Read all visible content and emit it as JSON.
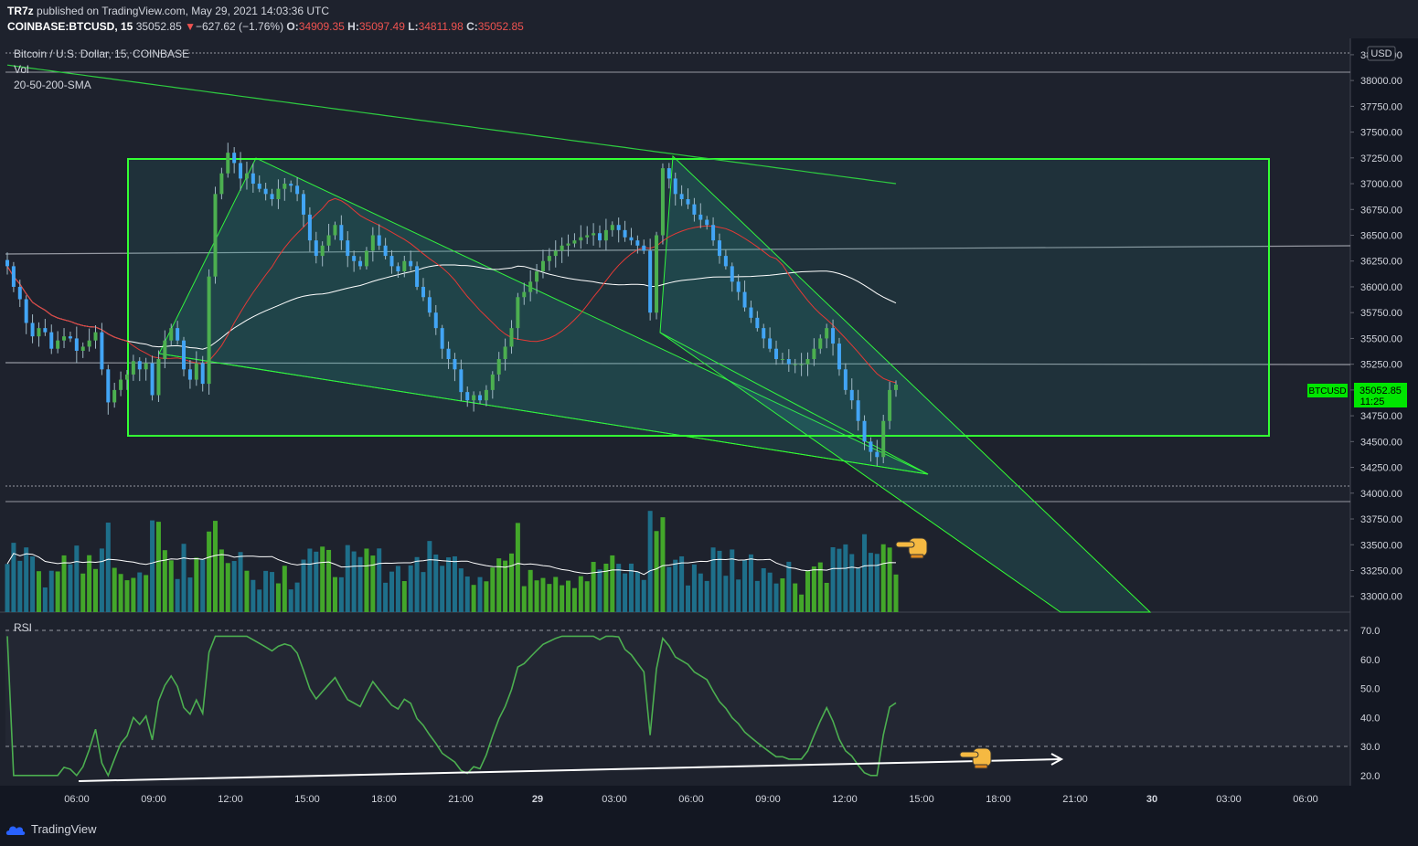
{
  "header": {
    "author": "TR7z",
    "published": "published on TradingView.com, May 29, 2021 14:03:36 UTC",
    "symbol": "COINBASE:BTCUSD, 15",
    "last": "35052.85",
    "change_arrow": "▼",
    "change": "−627.62 (−1.76%)",
    "o_label": "O:",
    "o": "34909.35",
    "h_label": "H:",
    "h": "35097.49",
    "l_label": "L:",
    "l": "34811.98",
    "c_label": "C:",
    "c": "35052.85"
  },
  "legend": {
    "title": "Bitcoin / U.S. Dollar, 15, COINBASE",
    "vol": "Vol",
    "sma": "20-50-200-SMA",
    "rsi": "RSI"
  },
  "price_axis": {
    "currency": "USD",
    "ticks": [
      "38250.00",
      "38000.00",
      "37750.00",
      "37500.00",
      "37250.00",
      "37000.00",
      "36750.00",
      "36500.00",
      "36250.00",
      "36000.00",
      "35750.00",
      "35500.00",
      "35250.00",
      "35000.00",
      "34750.00",
      "34500.00",
      "34250.00",
      "34000.00",
      "33750.00",
      "33500.00",
      "33250.00",
      "33000.00"
    ],
    "last_label": "BTCUSD",
    "last_value": "35052.85",
    "countdown": "11:25"
  },
  "rsi_axis": {
    "ticks": [
      "70.0",
      "60.0",
      "50.0",
      "40.0",
      "30.0",
      "20.0"
    ]
  },
  "time_axis": {
    "ticks": [
      "06:00",
      "09:00",
      "12:00",
      "15:00",
      "18:00",
      "21:00",
      "29",
      "03:00",
      "06:00",
      "09:00",
      "12:00",
      "15:00",
      "18:00",
      "21:00",
      "30",
      "03:00",
      "06:00"
    ]
  },
  "colors": {
    "background": "#131722",
    "bull": "#26a69a",
    "bear": "#2e7d32",
    "box": "#33ff33",
    "rsi_line": "#4caf50",
    "sma20": "#e53935",
    "sma50": "#ffffff",
    "sma200": "#2ecc40",
    "last_price_bg": "#00e600"
  },
  "footer": {
    "brand": "TradingView"
  },
  "chart_data": {
    "type": "candlestick",
    "title": "Bitcoin / U.S. Dollar, 15, COINBASE",
    "price_range": [
      32900,
      38320
    ],
    "price_series": [
      36200,
      36000,
      35880,
      35650,
      35520,
      35600,
      35560,
      35400,
      35480,
      35520,
      35500,
      35380,
      35420,
      35480,
      35560,
      35200,
      34880,
      35000,
      35100,
      35150,
      35280,
      35200,
      35260,
      34950,
      35300,
      35480,
      35600,
      35480,
      35200,
      35100,
      35260,
      35060,
      36100,
      36900,
      37100,
      37300,
      37200,
      37050,
      37100,
      37000,
      36950,
      36900,
      36850,
      36950,
      37000,
      36980,
      36900,
      36700,
      36450,
      36300,
      36400,
      36500,
      36600,
      36450,
      36300,
      36250,
      36200,
      36350,
      36500,
      36400,
      36300,
      36200,
      36150,
      36250,
      36200,
      36000,
      35900,
      35750,
      35600,
      35400,
      35300,
      35200,
      34980,
      34900,
      34950,
      34900,
      35000,
      35150,
      35300,
      35420,
      35600,
      35900,
      35950,
      36050,
      36150,
      36250,
      36300,
      36350,
      36400,
      36420,
      36450,
      36480,
      36500,
      36520,
      36450,
      36550,
      36600,
      36550,
      36480,
      36450,
      36400,
      36350,
      35750,
      36500,
      37150,
      37050,
      36900,
      36850,
      36800,
      36700,
      36650,
      36600,
      36450,
      36300,
      36200,
      36050,
      35950,
      35800,
      35700,
      35600,
      35500,
      35400,
      35300,
      35300,
      35250,
      35250,
      35250,
      35300,
      35400,
      35500,
      35600,
      35450,
      35200,
      35000,
      34900,
      34700,
      34500,
      34400,
      34350,
      34700,
      35000,
      35052
    ]
  }
}
